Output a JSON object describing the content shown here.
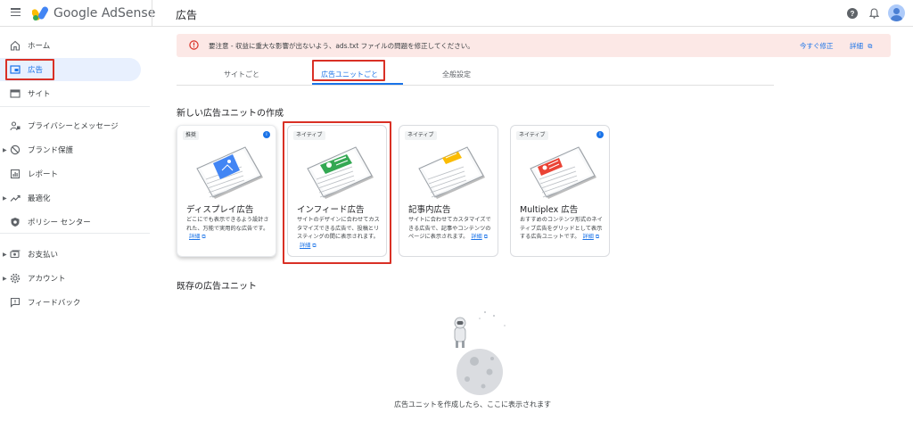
{
  "topbar": {
    "brand": "Google AdSense",
    "page_title": "広告",
    "icons": [
      "menu-icon",
      "adsense-logo",
      "help-icon",
      "notifications-icon",
      "avatar"
    ]
  },
  "sidebar": {
    "items": [
      {
        "label": "ホーム",
        "icon": "home-icon",
        "active": false,
        "caret": false
      },
      {
        "label": "広告",
        "icon": "ads-icon",
        "active": true,
        "caret": false
      },
      {
        "label": "サイト",
        "icon": "sites-icon",
        "active": false,
        "caret": false
      },
      {
        "label": "プライバシーとメッセージ",
        "icon": "privacy-icon",
        "active": false,
        "caret": false
      },
      {
        "label": "ブランド保護",
        "icon": "block-icon",
        "active": false,
        "caret": true
      },
      {
        "label": "レポート",
        "icon": "reports-icon",
        "active": false,
        "caret": false
      },
      {
        "label": "最適化",
        "icon": "trending-icon",
        "active": false,
        "caret": true
      },
      {
        "label": "ポリシー センター",
        "icon": "policy-icon",
        "active": false,
        "caret": false
      },
      {
        "label": "お支払い",
        "icon": "payments-icon",
        "active": false,
        "caret": true
      },
      {
        "label": "アカウント",
        "icon": "settings-icon",
        "active": false,
        "caret": true
      },
      {
        "label": "フィードバック",
        "icon": "feedback-icon",
        "active": false,
        "caret": false
      }
    ]
  },
  "alert": {
    "message": "要注意 - 収益に重大な影響が出ないよう、ads.txt ファイルの問題を修正してください。",
    "fix_label": "今すぐ修正",
    "details_label": "詳細"
  },
  "tabs": [
    {
      "label": "サイトごと",
      "active": false
    },
    {
      "label": "広告ユニットごと",
      "active": true
    },
    {
      "label": "全般設定",
      "active": false
    }
  ],
  "create_section": {
    "title": "新しい広告ユニットの作成",
    "cards": [
      {
        "badge": "推奨",
        "title": "ディスプレイ広告",
        "desc": "どこにでも表示できるよう設計された、万能で実用的な広告です。",
        "link": "詳細",
        "info": true,
        "accent": "#4285f4",
        "highlighted": false
      },
      {
        "badge": "ネイティブ",
        "title": "インフィード広告",
        "desc": "サイトのデザインに合わせてカスタマイズできる広告で、投稿とリスティングの間に表示されます。",
        "link": "詳細",
        "info": false,
        "accent": "#34a853",
        "highlighted": true
      },
      {
        "badge": "ネイティブ",
        "title": "記事内広告",
        "desc": "サイトに合わせてカスタマイズできる広告で、記事やコンテンツのページに表示されます。",
        "link": "詳細",
        "info": false,
        "accent": "#fbbc04",
        "highlighted": false
      },
      {
        "badge": "ネイティブ",
        "title": "Multiplex 広告",
        "desc": "おすすめのコンテンツ形式のネイティブ広告をグリッドとして表示する広告ユニットです。",
        "link": "詳細",
        "info": true,
        "accent": "#ea4335",
        "highlighted": false
      }
    ]
  },
  "existing_section": {
    "title": "既存の広告ユニット",
    "empty_text": "広告ユニットを作成したら、ここに表示されます"
  },
  "colors": {
    "primary": "#1a73e8",
    "highlight": "#d93025",
    "alert_bg": "#fce8e6",
    "alert_icon": "#d93025"
  }
}
